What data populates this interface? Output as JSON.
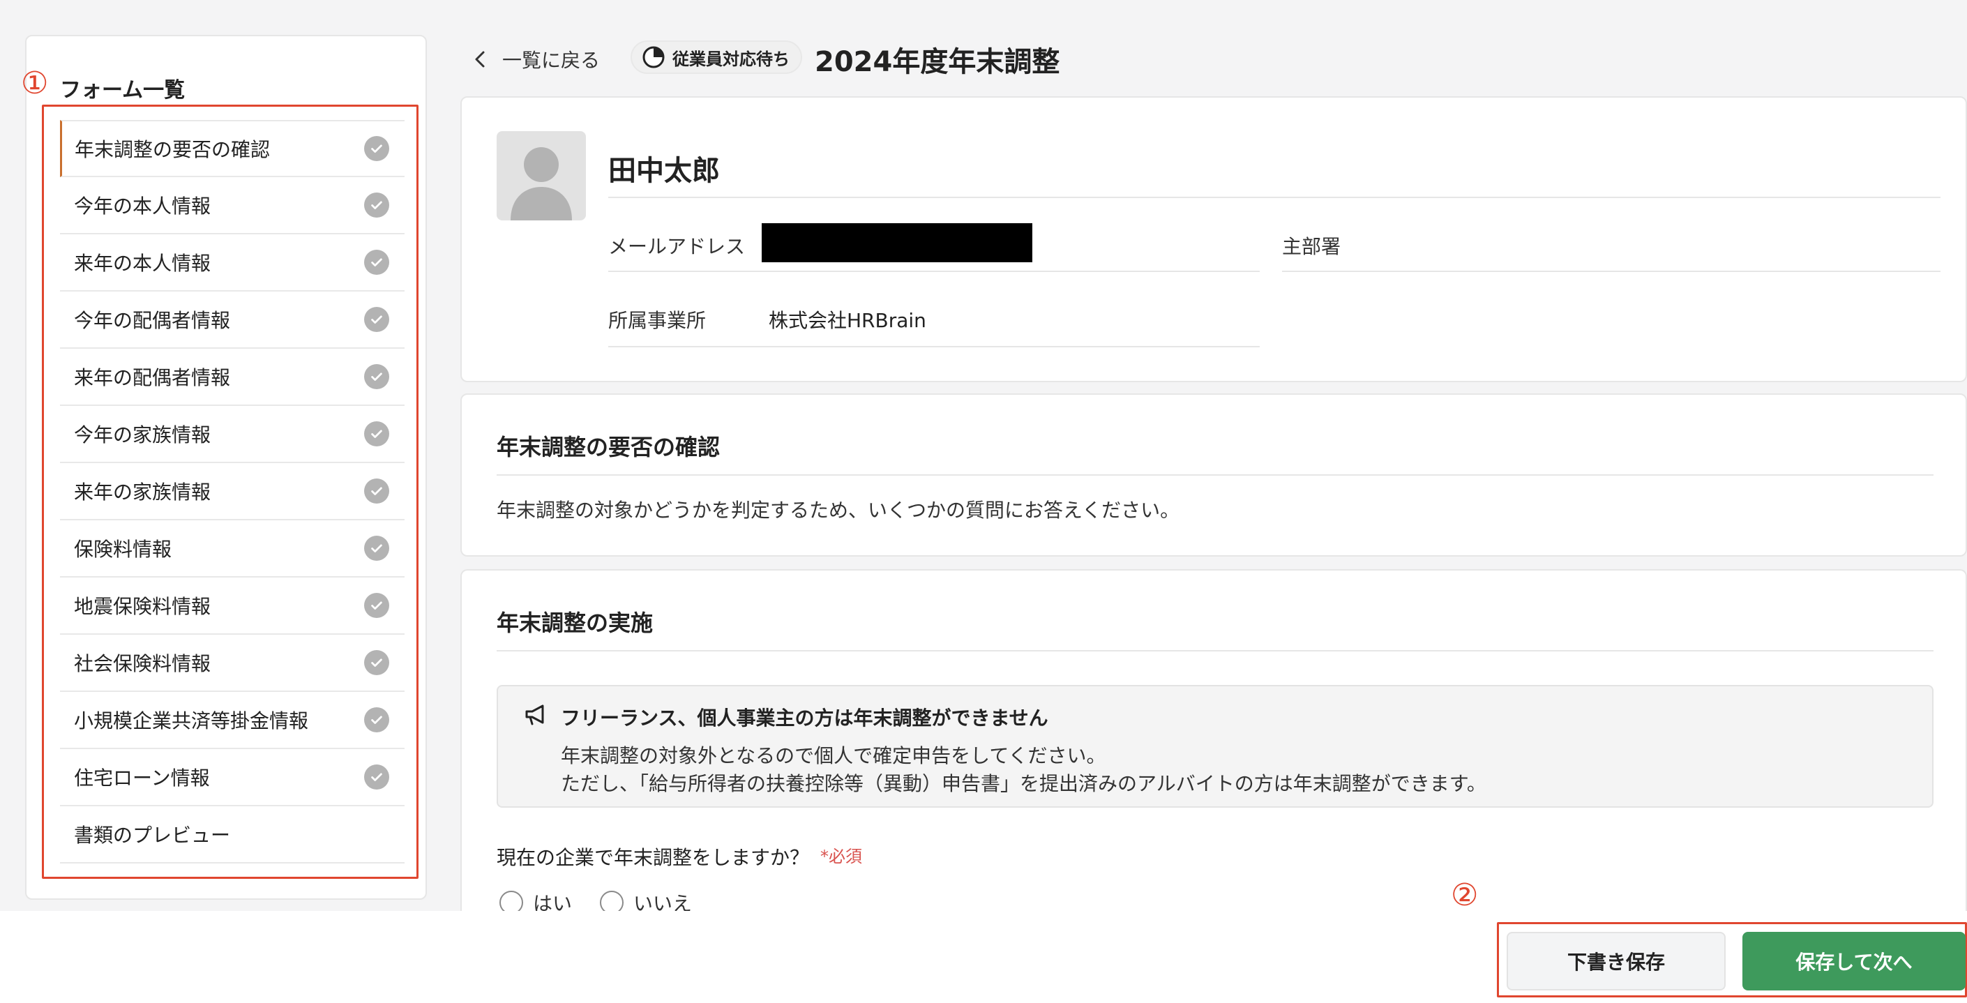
{
  "sidebar": {
    "title": "フォーム一覧",
    "items": [
      {
        "label": "年末調整の要否の確認",
        "done": true
      },
      {
        "label": "今年の本人情報",
        "done": true
      },
      {
        "label": "来年の本人情報",
        "done": true
      },
      {
        "label": "今年の配偶者情報",
        "done": true
      },
      {
        "label": "来年の配偶者情報",
        "done": true
      },
      {
        "label": "今年の家族情報",
        "done": true
      },
      {
        "label": "来年の家族情報",
        "done": true
      },
      {
        "label": "保険料情報",
        "done": true
      },
      {
        "label": "地震保険料情報",
        "done": true
      },
      {
        "label": "社会保険料情報",
        "done": true
      },
      {
        "label": "小規模企業共済等掛金情報",
        "done": true
      },
      {
        "label": "住宅ローン情報",
        "done": true
      },
      {
        "label": "書類のプレビュー",
        "done": false
      }
    ]
  },
  "annotations": {
    "marker1": "①",
    "marker2": "②",
    "color": "#e0462f"
  },
  "header": {
    "back_label": "一覧に戻る",
    "status": "従業員対応待ち",
    "title": "2024年度年末調整"
  },
  "profile": {
    "name": "田中太郎",
    "email_label": "メールアドレス",
    "department_label": "主部署",
    "office_label": "所属事業所",
    "office_value": "株式会社HRBrain"
  },
  "need_section": {
    "title": "年末調整の要否の確認",
    "description": "年末調整の対象かどうかを判定するため、いくつかの質問にお答えください。"
  },
  "impl_section": {
    "title": "年末調整の実施",
    "notice_title": "フリーランス、個人事業主の方は年末調整ができません",
    "notice_line1": "年末調整の対象外となるので個人で確定申告をしてください。",
    "notice_line2": "ただし、「給与所得者の扶養控除等（異動）申告書」を提出済みのアルバイトの方は年末調整ができます。",
    "question": "現在の企業で年末調整をしますか？",
    "required": "*必須",
    "option_yes": "はい",
    "option_no": "いいえ"
  },
  "footer": {
    "draft_label": "下書き保存",
    "next_label": "保存して次へ"
  },
  "colors": {
    "accent_green": "#3e9a5c",
    "active_marker": "#c9702f",
    "check_gray": "#b3b3b3"
  }
}
